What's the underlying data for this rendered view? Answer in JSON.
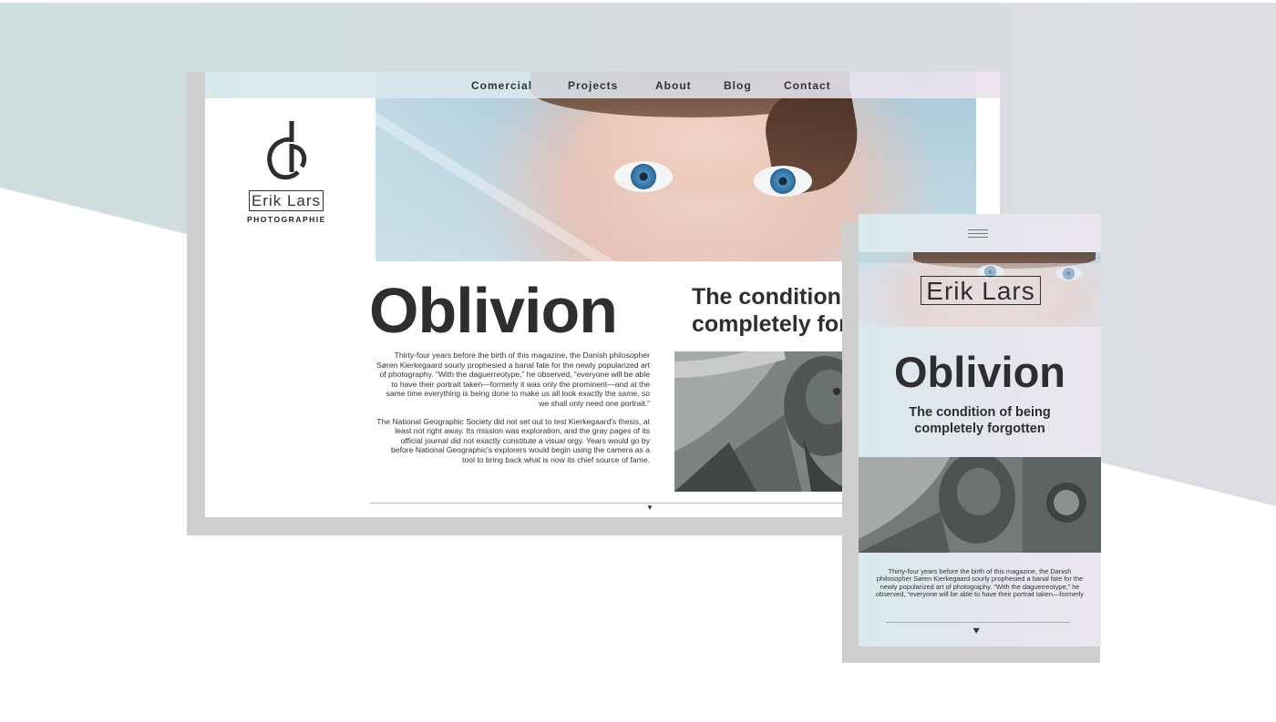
{
  "nav": {
    "items": [
      "Comercial",
      "Projects",
      "About",
      "Blog",
      "Contact"
    ]
  },
  "brand": {
    "name": "Erik Lars",
    "tagline": "PHOTOGRAPHIE"
  },
  "desktop": {
    "title": "Oblivion",
    "subtitle": "The condition of being completely forgotten",
    "body": [
      "Thirty-four years before the birth of this magazine, the Danish philosopher Søren Kierkegaard sourly prophesied a banal fate for the newly popularized art of photography. “With the daguerreotype,” he observed, “everyone will be able to have their portrait taken—formerly it was only the prominent—and at the same time everything is being done to make us all look exactly the same, so we shall only need one portrait.”",
      "The National Geographic Society did not set out to test Kierkegaard's thesis, at least not right away. Its mission was exploration, and the gray pages of its official journal did not exactly constitute a visual orgy. Years would go by before National Geographic's explorers would begin using the camera as a tool to bring back what is now its chief source of fame."
    ],
    "scroll_icon": "chevron-down-icon"
  },
  "mobile": {
    "menu_icon": "hamburger-menu-icon",
    "title": "Oblivion",
    "subtitle": "The condition of being completely forgotten",
    "body": "Thirty-four years before the birth of this magazine, the Danish philosopher Søren Kierkegaard sourly prophesied a banal fate for the newly popularized art of photography. “With the daguerreotype,” he observed, “everyone will be able to have their portrait taken—formerly it was only the prominent—and at the same time everything is being done to make us all look exactly the same.”",
    "scroll_icon": "double-chevron-down-icon"
  },
  "colors": {
    "text": "#2e2e30",
    "band": "#d5dcdf",
    "iris": "#2b6d9e"
  }
}
